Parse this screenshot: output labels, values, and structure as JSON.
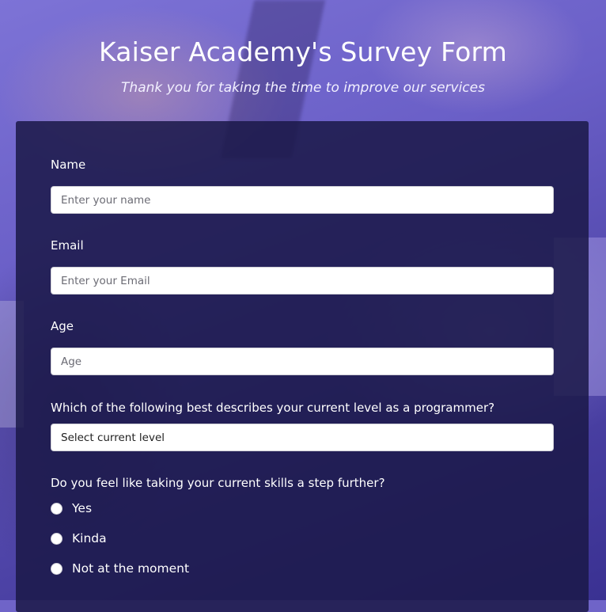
{
  "header": {
    "title": "Kaiser Academy's Survey Form",
    "subtitle": "Thank you for taking the time to improve our services"
  },
  "form": {
    "name": {
      "label": "Name",
      "placeholder": "Enter your name",
      "value": ""
    },
    "email": {
      "label": "Email",
      "placeholder": "Enter your Email",
      "value": ""
    },
    "age": {
      "label": "Age",
      "placeholder": "Age",
      "value": ""
    },
    "level": {
      "label": "Which of the following best describes your current level as a programmer?",
      "selected": "Select current level"
    },
    "further": {
      "label": "Do you feel like taking your current skills a step further?",
      "options": [
        "Yes",
        "Kinda",
        "Not at the moment"
      ]
    }
  },
  "colors": {
    "background": "#6f64c8",
    "card": "#1b1848",
    "text": "#ffffff"
  }
}
